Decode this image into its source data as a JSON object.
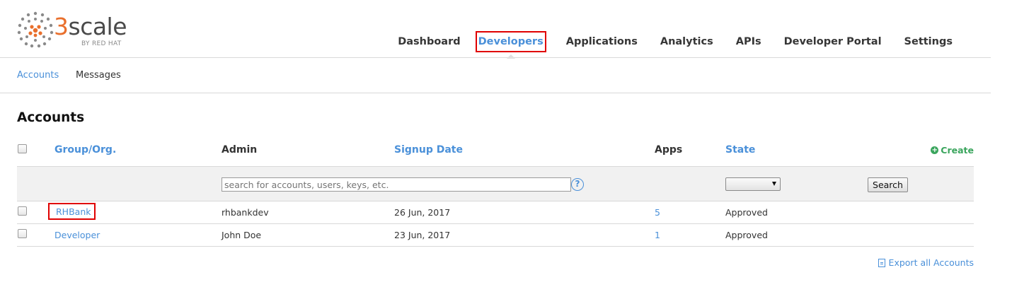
{
  "brand": {
    "wordmark_accent": "3",
    "wordmark_rest": "scale",
    "subtitle": "BY RED HAT",
    "accent_color": "#e96f2c",
    "link_color": "#4a90d9",
    "highlight_color": "#e00000"
  },
  "mainnav": {
    "items": [
      {
        "label": "Dashboard"
      },
      {
        "label": "Developers"
      },
      {
        "label": "Applications"
      },
      {
        "label": "Analytics"
      },
      {
        "label": "APIs"
      },
      {
        "label": "Developer Portal"
      },
      {
        "label": "Settings"
      }
    ],
    "active": "Developers"
  },
  "subnav": {
    "accounts": "Accounts",
    "messages": "Messages"
  },
  "page": {
    "title": "Accounts"
  },
  "table": {
    "headers": {
      "group": "Group/Org.",
      "admin": "Admin",
      "signup": "Signup Date",
      "apps": "Apps",
      "state": "State"
    },
    "create_label": "Create",
    "search": {
      "placeholder": "search for accounts, users, keys, etc.",
      "help_icon": "?",
      "state_selected": "",
      "button_label": "Search"
    },
    "rows": [
      {
        "group": "RHBank",
        "admin": "rhbankdev",
        "signup": "26 Jun, 2017",
        "apps": "5",
        "state": "Approved"
      },
      {
        "group": "Developer",
        "admin": "John Doe",
        "signup": "23 Jun, 2017",
        "apps": "1",
        "state": "Approved"
      }
    ]
  },
  "footer": {
    "export_label": "Export all Accounts"
  }
}
